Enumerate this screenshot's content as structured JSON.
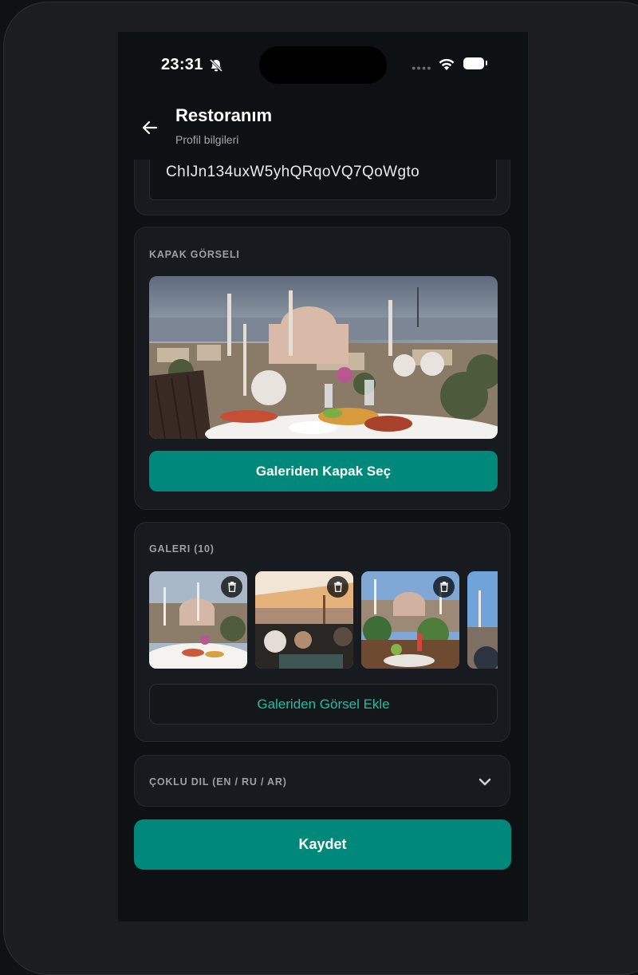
{
  "status_bar": {
    "time": "23:31"
  },
  "header": {
    "title": "Restoranım",
    "subtitle": "Profil bilgileri"
  },
  "place": {
    "id_value": "ChIJn134uxW5yhQRqoVQ7QoWgto"
  },
  "cover": {
    "label": "KAPAK GÖRSELI",
    "button_label": "Galeriden Kapak Seç"
  },
  "gallery": {
    "label": "GALERI (10)",
    "add_button_label": "Galeriden Görsel Ekle"
  },
  "languages": {
    "label": "ÇOKLU DIL (EN / RU / AR)"
  },
  "actions": {
    "save_label": "Kaydet"
  },
  "colors": {
    "accent": "#00897b",
    "accent_text": "#1fbfa5",
    "background": "#0e1113",
    "card": "#171b1f"
  },
  "icons": [
    "bell-off-icon",
    "wifi-icon",
    "battery-icon",
    "back-arrow-icon",
    "trash-icon",
    "chevron-down-icon"
  ]
}
